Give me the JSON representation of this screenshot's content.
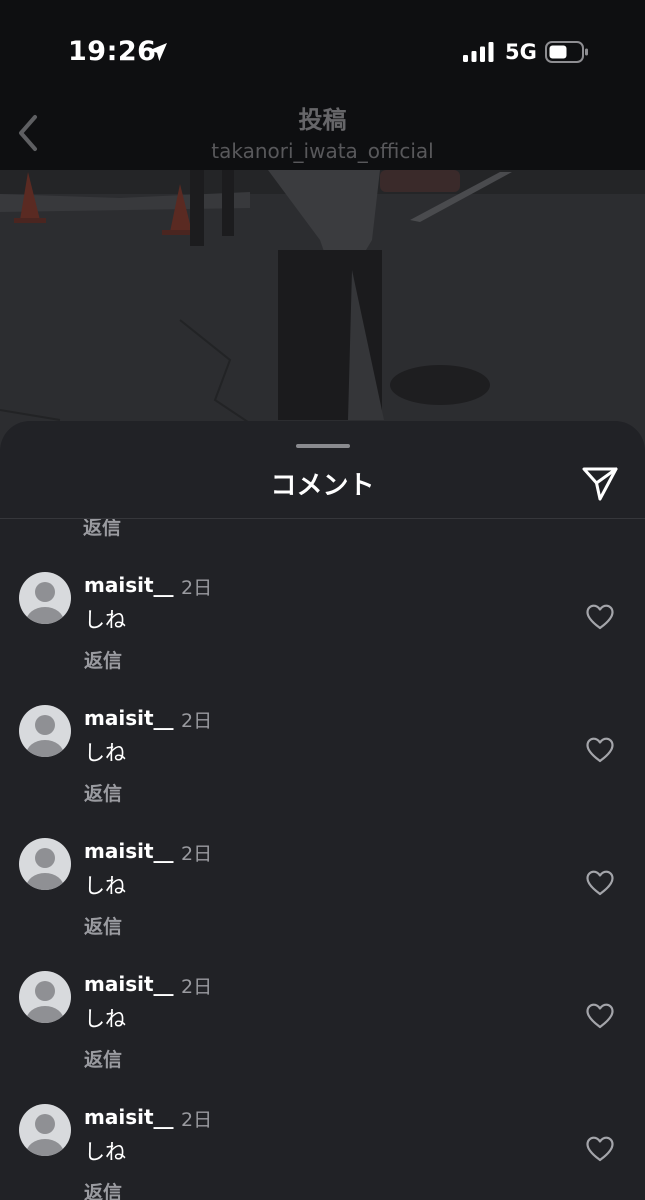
{
  "status": {
    "time": "19:26",
    "network": "5G"
  },
  "post": {
    "title": "投稿",
    "username": "takanori_iwata_official"
  },
  "sheet": {
    "title": "コメント",
    "top_reply_label": "返信"
  },
  "comments": [
    {
      "user": "maisit__",
      "time": "2日",
      "text": "しね",
      "reply": "返信"
    },
    {
      "user": "maisit__",
      "time": "2日",
      "text": "しね",
      "reply": "返信"
    },
    {
      "user": "maisit__",
      "time": "2日",
      "text": "しね",
      "reply": "返信"
    },
    {
      "user": "maisit__",
      "time": "2日",
      "text": "しね",
      "reply": "返信"
    },
    {
      "user": "maisit__",
      "time": "2日",
      "text": "しね",
      "reply": "返信"
    }
  ],
  "icons": {
    "status": [
      "location-arrow-icon",
      "cellular-signal-icon",
      "battery-icon"
    ],
    "header": [
      "back-chevron-icon"
    ],
    "sheet": [
      "share-send-icon",
      "default-avatar-icon",
      "heart-icon"
    ]
  },
  "colors": {
    "sheet_background": "#212226",
    "header_background": "#0e0f11",
    "secondary_text": "#9a9ba0",
    "avatar_background": "#d8dadd"
  }
}
